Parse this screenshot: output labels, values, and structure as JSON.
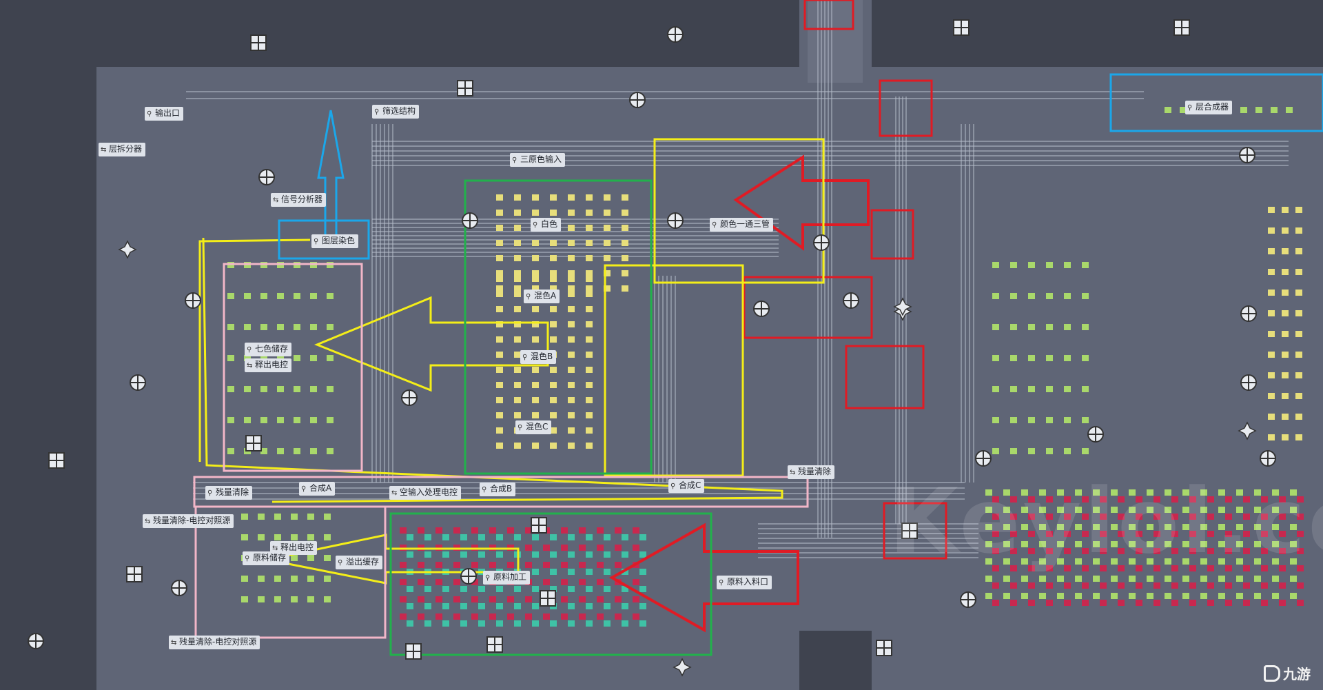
{
  "labels": {
    "output_port": "输出口",
    "filter_structure": "筛选结构",
    "layer_splitter": "层拆分器",
    "primary_color_input": "三原色输入",
    "signal_analyzer": "信号分析器",
    "dye_color": "图层染色",
    "white": "白色",
    "color_channel": "颜色一通三管",
    "mix_a": "混色A",
    "mix_b": "混色B",
    "mix_c": "混色C",
    "seven_color_storage": "七色储存",
    "release_control": "释出电控",
    "residual_clear_right": "残量清除",
    "residual_clear_left": "残量清除",
    "synth_a": "合成A",
    "empty_input_control": "空输入处理电控",
    "synth_b": "合成B",
    "synth_c": "合成C",
    "residual_clear_ref_1": "残量清除-电控对照源",
    "release_control_2": "释出电控",
    "raw_storage": "原料储存",
    "overflow_cache": "溢出缓存",
    "raw_processing": "原料加工",
    "raw_input": "原料入料口",
    "residual_clear_ref_2": "残量清除-电控对照源",
    "layer_combiner": "层合成器"
  },
  "watermark": "Keylol.com",
  "logo": "九游",
  "colors": {
    "background": "#3f434f",
    "floor": "#5f6576",
    "belt": "#b5bcca",
    "red_box": "#e01b24",
    "yellow_box": "#f4ee18",
    "green_box": "#22b14c",
    "blue_box": "#1ba7ea",
    "pink_box": "#f2b6c8",
    "machine_yellow": "#e7de7b",
    "machine_green": "#a9d86b",
    "machine_red": "#c8284f",
    "machine_teal": "#3fc2a6"
  },
  "icons": [
    "square-hub-icon",
    "circle-hub-icon",
    "half-circle-hub-icon",
    "star-rotator-icon",
    "pin-marker-icon",
    "splitter-marker-icon"
  ]
}
